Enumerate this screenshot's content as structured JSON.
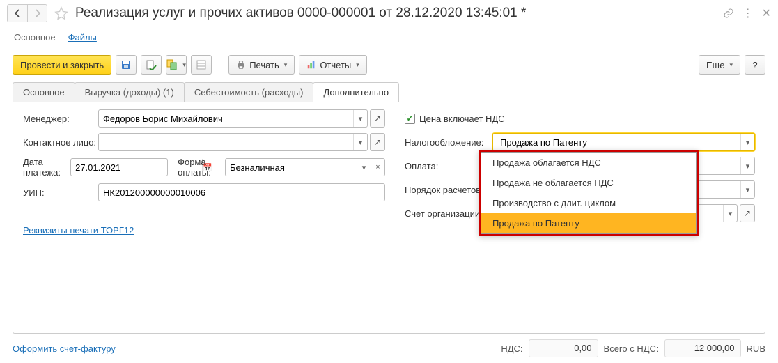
{
  "title": "Реализация услуг и прочих активов 0000-000001 от 28.12.2020 13:45:01 *",
  "topnav": {
    "main": "Основное",
    "files": "Файлы"
  },
  "toolbar": {
    "post_close": "Провести и закрыть",
    "print": "Печать",
    "reports": "Отчеты",
    "more": "Еще"
  },
  "tabs": {
    "t0": "Основное",
    "t1": "Выручка (доходы) (1)",
    "t2": "Себестоимость (расходы)",
    "t3": "Дополнительно"
  },
  "labels": {
    "manager": "Менеджер:",
    "contact": "Контактное лицо:",
    "paydate": "Дата платежа:",
    "payform": "Форма оплаты:",
    "uip": "УИП:",
    "vat_incl": "Цена включает НДС",
    "tax": "Налогообложение:",
    "payment": "Оплата:",
    "calc_order": "Порядок расчетов:",
    "org_account": "Счет организации:",
    "torg12": "Реквизиты печати ТОРГ12"
  },
  "values": {
    "manager": "Федоров Борис Михайлович",
    "contact": "",
    "paydate": "27.01.2021",
    "payform": "Безналичная",
    "uip": "НК201200000000010006",
    "tax": "Продажа по Патенту",
    "payment": "",
    "calc_order": "",
    "org_account": ""
  },
  "dropdown": {
    "o0": "Продажа облагается НДС",
    "o1": "Продажа не облагается НДС",
    "o2": "Производство с длит. циклом",
    "o3": "Продажа по Патенту"
  },
  "footer": {
    "invoice": "Оформить счет-фактуру",
    "vat_lbl": "НДС:",
    "vat_val": "0,00",
    "total_lbl": "Всего с НДС:",
    "total_val": "12 000,00",
    "cur": "RUB"
  }
}
